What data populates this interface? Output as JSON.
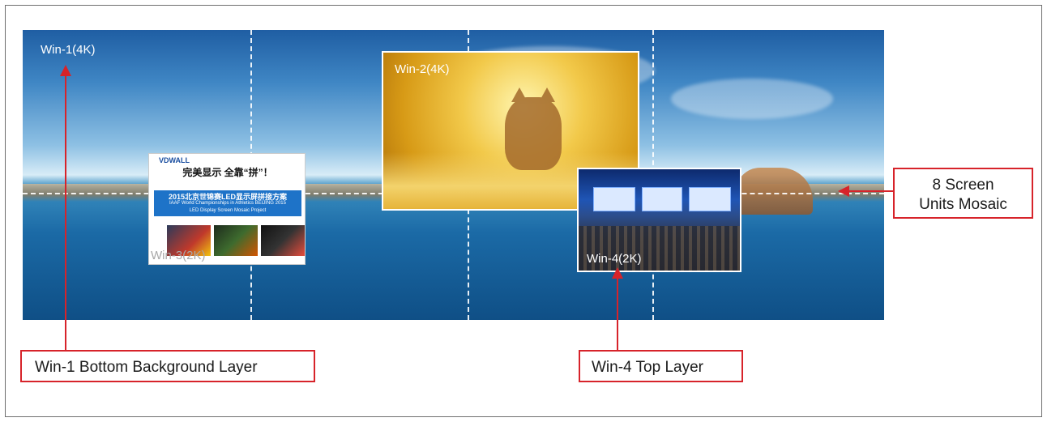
{
  "wall": {
    "win1_label": "Win-1(4K)",
    "win2_label": "Win-2(4K)",
    "win3_label": "Win-3(2K)",
    "win4_label": "Win-4(2K)"
  },
  "win3_content": {
    "logo": "VDWALL",
    "slogan": "完美显示 全靠“拼”！",
    "title_cn": "2015北京世锦赛LED显示屏拼接方案",
    "title_en_1": "IAAF World Championships in Athletics BEIJING 2015",
    "title_en_2": "LED Display Screen  Mosaic Project"
  },
  "annotations": {
    "bottom_layer": "Win-1 Bottom Background Layer",
    "top_layer": "Win-4 Top Layer",
    "mosaic_line1": "8 Screen",
    "mosaic_line2": "Units Mosaic"
  },
  "colors": {
    "annotation_red": "#d7232a",
    "grid_dash": "#ffffff"
  }
}
